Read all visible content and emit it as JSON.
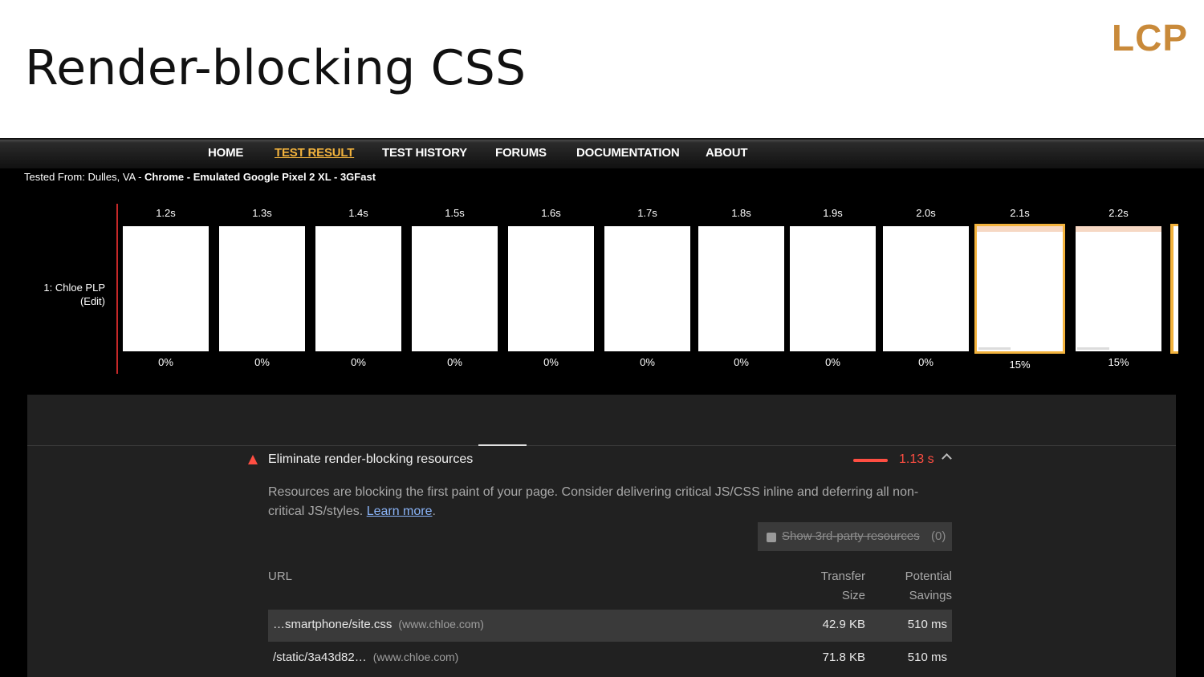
{
  "slide": {
    "title": "Render-blocking CSS",
    "tag": "LCP",
    "tag_color": "#c98a3a"
  },
  "navbar": {
    "items": [
      {
        "label": "HOME",
        "active": false
      },
      {
        "label": "TEST RESULT",
        "active": true
      },
      {
        "label": "TEST HISTORY",
        "active": false
      },
      {
        "label": "FORUMS",
        "active": false
      },
      {
        "label": "DOCUMENTATION",
        "active": false
      },
      {
        "label": "ABOUT",
        "active": false
      }
    ],
    "active_color": "#f3b33d"
  },
  "test_info": {
    "prefix": "Tested From: Dulles, VA - ",
    "config": "Chrome - Emulated Google Pixel 2 XL - 3GFast"
  },
  "filmstrip": {
    "test_label": "1: Chloe PLP",
    "edit_label": "(Edit)",
    "frames": [
      {
        "time": "1.2s",
        "pct": "0%",
        "highlight": false,
        "content": false
      },
      {
        "time": "1.3s",
        "pct": "0%",
        "highlight": false,
        "content": false
      },
      {
        "time": "1.4s",
        "pct": "0%",
        "highlight": false,
        "content": false
      },
      {
        "time": "1.5s",
        "pct": "0%",
        "highlight": false,
        "content": false
      },
      {
        "time": "1.6s",
        "pct": "0%",
        "highlight": false,
        "content": false
      },
      {
        "time": "1.7s",
        "pct": "0%",
        "highlight": false,
        "content": false
      },
      {
        "time": "1.8s",
        "pct": "0%",
        "highlight": false,
        "content": false
      },
      {
        "time": "1.9s",
        "pct": "0%",
        "highlight": false,
        "content": false
      },
      {
        "time": "2.0s",
        "pct": "0%",
        "highlight": false,
        "content": false
      },
      {
        "time": "2.1s",
        "pct": "15%",
        "highlight": true,
        "content": true
      },
      {
        "time": "2.2s",
        "pct": "15%",
        "highlight": false,
        "content": true
      }
    ]
  },
  "audit": {
    "title": "Eliminate render-blocking resources",
    "savings": "1.13 s",
    "status_color": "#ff4e42",
    "description": "Resources are blocking the first paint of your page. Consider delivering critical JS/CSS inline and deferring all non-critical JS/styles. ",
    "learn_more": "Learn more",
    "desc_end": ".",
    "third_party_label": "Show 3rd-party resources",
    "third_party_count": "(0)",
    "columns": {
      "url": "URL",
      "transfer_line1": "Transfer",
      "transfer_line2": "Size",
      "savings_line1": "Potential",
      "savings_line2": "Savings"
    },
    "rows": [
      {
        "url": "…smartphone/site.css",
        "host": "(www.chloe.com)",
        "size": "42.9 KB",
        "savings": "510 ms"
      },
      {
        "url": "/static/3a43d82…",
        "host": "(www.chloe.com)",
        "size": "71.8 KB",
        "savings": "510 ms"
      }
    ]
  }
}
